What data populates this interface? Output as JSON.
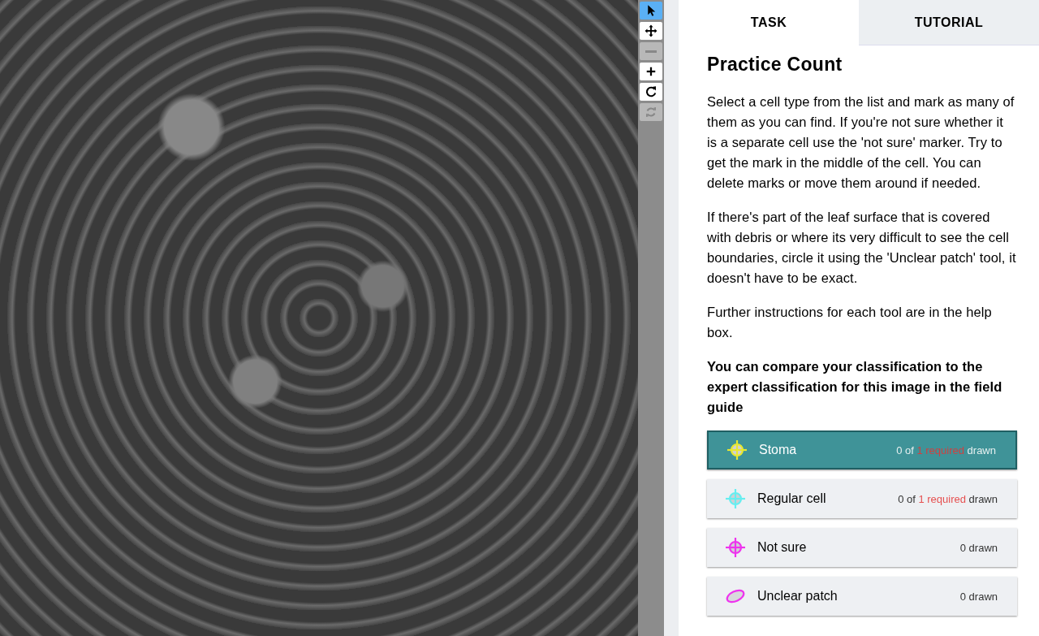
{
  "toolbar": [
    {
      "kind": "pointer",
      "selected": true,
      "disabled": false
    },
    {
      "kind": "move",
      "selected": false,
      "disabled": false
    },
    {
      "kind": "zoom-out",
      "selected": false,
      "disabled": true
    },
    {
      "kind": "zoom-in",
      "selected": false,
      "disabled": false
    },
    {
      "kind": "rotate",
      "selected": false,
      "disabled": false
    },
    {
      "kind": "reset",
      "selected": false,
      "disabled": true
    }
  ],
  "tabs": [
    {
      "label": "TASK",
      "selected": true
    },
    {
      "label": "TUTORIAL",
      "selected": false
    }
  ],
  "task": {
    "title": "Practice Count",
    "paragraphs": [
      {
        "text": "Select a cell type from the list and mark as many of them as you can find. If you're not sure whether it is a separate cell use the 'not sure' marker. Try to get the mark in the middle of the cell. You can delete marks or move them around if needed.",
        "bold": false
      },
      {
        "text": "If there's part of the leaf surface that is covered with debris or where its very difficult to see the cell boundaries, circle it using the 'Unclear patch' tool, it doesn't have to be exact.",
        "bold": false
      },
      {
        "text": "Further instructions for each tool are in the help box.",
        "bold": false
      },
      {
        "text": "You can compare your classification to the expert classification for this image in the field guide",
        "bold": true
      }
    ],
    "tools": [
      {
        "label": "Stoma",
        "kind": "point",
        "color": "#e8e830",
        "selected": true,
        "status": [
          {
            "text": "0 of",
            "kind": "plain"
          },
          {
            "text": "1 required",
            "kind": "required"
          },
          {
            "text": "drawn",
            "kind": "plain"
          }
        ]
      },
      {
        "label": "Regular cell",
        "kind": "point",
        "color": "#66eef0",
        "selected": false,
        "status": [
          {
            "text": "0 of",
            "kind": "plain"
          },
          {
            "text": "1 required",
            "kind": "required"
          },
          {
            "text": "drawn",
            "kind": "plain"
          }
        ]
      },
      {
        "label": "Not sure",
        "kind": "point",
        "color": "#ee33ee",
        "selected": false,
        "status": [
          {
            "text": "0 drawn",
            "kind": "plain"
          }
        ]
      },
      {
        "label": "Unclear patch",
        "kind": "ellipse",
        "color": "#ee33ee",
        "selected": false,
        "status": [
          {
            "text": "0 drawn",
            "kind": "plain"
          }
        ]
      }
    ]
  }
}
